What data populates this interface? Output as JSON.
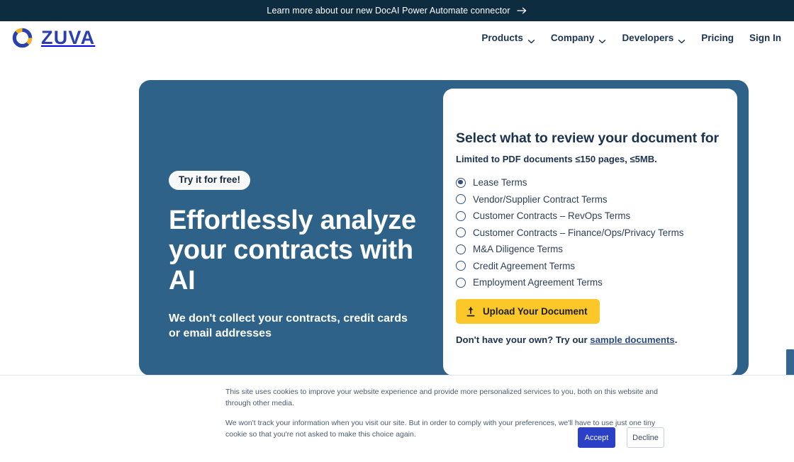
{
  "announcement": {
    "text": "Learn more about our new DocAI Power Automate connector",
    "icon": "arrow-right-icon"
  },
  "header": {
    "logo": {
      "word": "ZUVA",
      "icon": "zuva-ring-logo-icon",
      "colors": {
        "blue": "#2b3fae",
        "yellow": "#f5b31e"
      }
    },
    "nav": [
      {
        "label": "Products",
        "has_dropdown": true
      },
      {
        "label": "Company",
        "has_dropdown": true
      },
      {
        "label": "Developers",
        "has_dropdown": true
      },
      {
        "label": "Pricing",
        "has_dropdown": false
      },
      {
        "label": "Sign In",
        "has_dropdown": false
      }
    ]
  },
  "hero": {
    "badge": "Try it for free!",
    "title": "Effortlessly analyze your contracts with AI",
    "subtitle": "We don't collect your contracts, credit cards or email addresses",
    "panel_color": "#2e6288"
  },
  "card": {
    "title": "Select what to review your document for",
    "note": "Limited to PDF documents ≤150 pages, ≤5MB.",
    "options": [
      {
        "label": "Lease Terms",
        "selected": true
      },
      {
        "label": "Vendor/Supplier Contract Terms",
        "selected": false
      },
      {
        "label": "Customer Contracts – RevOps Terms",
        "selected": false
      },
      {
        "label": "Customer Contracts – Finance/Ops/Privacy Terms",
        "selected": false
      },
      {
        "label": "M&A Diligence Terms",
        "selected": false
      },
      {
        "label": "Credit Agreement Terms",
        "selected": false
      },
      {
        "label": "Employment Agreement Terms",
        "selected": false
      }
    ],
    "upload_button": {
      "label": "Upload Your Document",
      "icon": "upload-icon",
      "color": "#fcc728"
    },
    "sample": {
      "prefix": "Don't have your own? Try our ",
      "link": "sample documents",
      "suffix": "."
    }
  },
  "cookie_banner": {
    "paragraph1": "This site uses cookies to improve your website experience and provide more personalized services to you, both on this website and through other media.",
    "paragraph2": "We won't track your information when you visit our site. But in order to comply with your preferences, we'll have to use just one tiny cookie so that you're not asked to make this choice again.",
    "accept_label": "Accept",
    "decline_label": "Decline",
    "accept_color": "#2b3fc7"
  }
}
